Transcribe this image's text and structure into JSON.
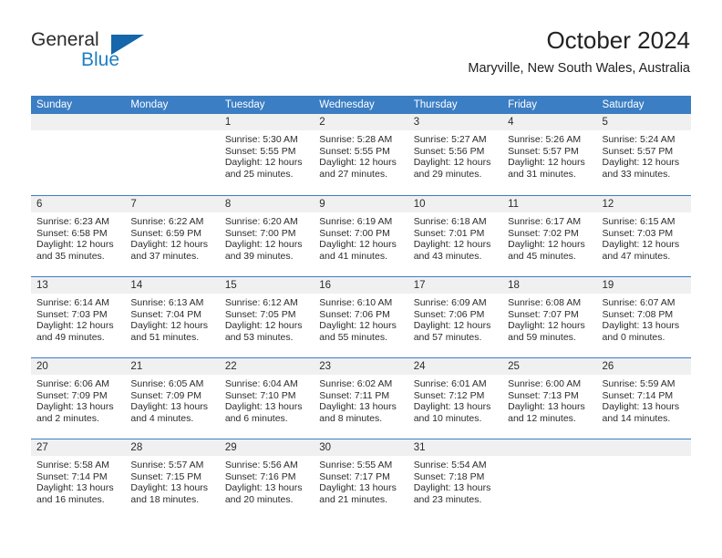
{
  "branding": {
    "logo_primary": "General",
    "logo_secondary": "Blue",
    "logo_accent_color": "#1f7fc4",
    "logo_triangle_color": "#1566ab",
    "triangle_icon_name": "blue-triangle-icon"
  },
  "header": {
    "title": "October 2024",
    "subtitle": "Maryville, New South Wales, Australia"
  },
  "theme": {
    "header_blue": "#3b7ec4",
    "day_band_gray": "#f0f0f0",
    "text_color": "#2b2b2b"
  },
  "weekdays": [
    "Sunday",
    "Monday",
    "Tuesday",
    "Wednesday",
    "Thursday",
    "Friday",
    "Saturday"
  ],
  "labels": {
    "sunrise_prefix": "Sunrise:",
    "sunset_prefix": "Sunset:",
    "daylight_prefix": "Daylight:"
  },
  "weeks": [
    [
      {
        "day": "",
        "empty": true
      },
      {
        "day": "",
        "empty": true
      },
      {
        "day": "1",
        "sunrise": "Sunrise: 5:30 AM",
        "sunset": "Sunset: 5:55 PM",
        "daylight": "Daylight: 12 hours and 25 minutes."
      },
      {
        "day": "2",
        "sunrise": "Sunrise: 5:28 AM",
        "sunset": "Sunset: 5:55 PM",
        "daylight": "Daylight: 12 hours and 27 minutes."
      },
      {
        "day": "3",
        "sunrise": "Sunrise: 5:27 AM",
        "sunset": "Sunset: 5:56 PM",
        "daylight": "Daylight: 12 hours and 29 minutes."
      },
      {
        "day": "4",
        "sunrise": "Sunrise: 5:26 AM",
        "sunset": "Sunset: 5:57 PM",
        "daylight": "Daylight: 12 hours and 31 minutes."
      },
      {
        "day": "5",
        "sunrise": "Sunrise: 5:24 AM",
        "sunset": "Sunset: 5:57 PM",
        "daylight": "Daylight: 12 hours and 33 minutes."
      }
    ],
    [
      {
        "day": "6",
        "sunrise": "Sunrise: 6:23 AM",
        "sunset": "Sunset: 6:58 PM",
        "daylight": "Daylight: 12 hours and 35 minutes."
      },
      {
        "day": "7",
        "sunrise": "Sunrise: 6:22 AM",
        "sunset": "Sunset: 6:59 PM",
        "daylight": "Daylight: 12 hours and 37 minutes."
      },
      {
        "day": "8",
        "sunrise": "Sunrise: 6:20 AM",
        "sunset": "Sunset: 7:00 PM",
        "daylight": "Daylight: 12 hours and 39 minutes."
      },
      {
        "day": "9",
        "sunrise": "Sunrise: 6:19 AM",
        "sunset": "Sunset: 7:00 PM",
        "daylight": "Daylight: 12 hours and 41 minutes."
      },
      {
        "day": "10",
        "sunrise": "Sunrise: 6:18 AM",
        "sunset": "Sunset: 7:01 PM",
        "daylight": "Daylight: 12 hours and 43 minutes."
      },
      {
        "day": "11",
        "sunrise": "Sunrise: 6:17 AM",
        "sunset": "Sunset: 7:02 PM",
        "daylight": "Daylight: 12 hours and 45 minutes."
      },
      {
        "day": "12",
        "sunrise": "Sunrise: 6:15 AM",
        "sunset": "Sunset: 7:03 PM",
        "daylight": "Daylight: 12 hours and 47 minutes."
      }
    ],
    [
      {
        "day": "13",
        "sunrise": "Sunrise: 6:14 AM",
        "sunset": "Sunset: 7:03 PM",
        "daylight": "Daylight: 12 hours and 49 minutes."
      },
      {
        "day": "14",
        "sunrise": "Sunrise: 6:13 AM",
        "sunset": "Sunset: 7:04 PM",
        "daylight": "Daylight: 12 hours and 51 minutes."
      },
      {
        "day": "15",
        "sunrise": "Sunrise: 6:12 AM",
        "sunset": "Sunset: 7:05 PM",
        "daylight": "Daylight: 12 hours and 53 minutes."
      },
      {
        "day": "16",
        "sunrise": "Sunrise: 6:10 AM",
        "sunset": "Sunset: 7:06 PM",
        "daylight": "Daylight: 12 hours and 55 minutes."
      },
      {
        "day": "17",
        "sunrise": "Sunrise: 6:09 AM",
        "sunset": "Sunset: 7:06 PM",
        "daylight": "Daylight: 12 hours and 57 minutes."
      },
      {
        "day": "18",
        "sunrise": "Sunrise: 6:08 AM",
        "sunset": "Sunset: 7:07 PM",
        "daylight": "Daylight: 12 hours and 59 minutes."
      },
      {
        "day": "19",
        "sunrise": "Sunrise: 6:07 AM",
        "sunset": "Sunset: 7:08 PM",
        "daylight": "Daylight: 13 hours and 0 minutes."
      }
    ],
    [
      {
        "day": "20",
        "sunrise": "Sunrise: 6:06 AM",
        "sunset": "Sunset: 7:09 PM",
        "daylight": "Daylight: 13 hours and 2 minutes."
      },
      {
        "day": "21",
        "sunrise": "Sunrise: 6:05 AM",
        "sunset": "Sunset: 7:09 PM",
        "daylight": "Daylight: 13 hours and 4 minutes."
      },
      {
        "day": "22",
        "sunrise": "Sunrise: 6:04 AM",
        "sunset": "Sunset: 7:10 PM",
        "daylight": "Daylight: 13 hours and 6 minutes."
      },
      {
        "day": "23",
        "sunrise": "Sunrise: 6:02 AM",
        "sunset": "Sunset: 7:11 PM",
        "daylight": "Daylight: 13 hours and 8 minutes."
      },
      {
        "day": "24",
        "sunrise": "Sunrise: 6:01 AM",
        "sunset": "Sunset: 7:12 PM",
        "daylight": "Daylight: 13 hours and 10 minutes."
      },
      {
        "day": "25",
        "sunrise": "Sunrise: 6:00 AM",
        "sunset": "Sunset: 7:13 PM",
        "daylight": "Daylight: 13 hours and 12 minutes."
      },
      {
        "day": "26",
        "sunrise": "Sunrise: 5:59 AM",
        "sunset": "Sunset: 7:14 PM",
        "daylight": "Daylight: 13 hours and 14 minutes."
      }
    ],
    [
      {
        "day": "27",
        "sunrise": "Sunrise: 5:58 AM",
        "sunset": "Sunset: 7:14 PM",
        "daylight": "Daylight: 13 hours and 16 minutes."
      },
      {
        "day": "28",
        "sunrise": "Sunrise: 5:57 AM",
        "sunset": "Sunset: 7:15 PM",
        "daylight": "Daylight: 13 hours and 18 minutes."
      },
      {
        "day": "29",
        "sunrise": "Sunrise: 5:56 AM",
        "sunset": "Sunset: 7:16 PM",
        "daylight": "Daylight: 13 hours and 20 minutes."
      },
      {
        "day": "30",
        "sunrise": "Sunrise: 5:55 AM",
        "sunset": "Sunset: 7:17 PM",
        "daylight": "Daylight: 13 hours and 21 minutes."
      },
      {
        "day": "31",
        "sunrise": "Sunrise: 5:54 AM",
        "sunset": "Sunset: 7:18 PM",
        "daylight": "Daylight: 13 hours and 23 minutes."
      },
      {
        "day": "",
        "empty": true
      },
      {
        "day": "",
        "empty": true
      }
    ]
  ]
}
